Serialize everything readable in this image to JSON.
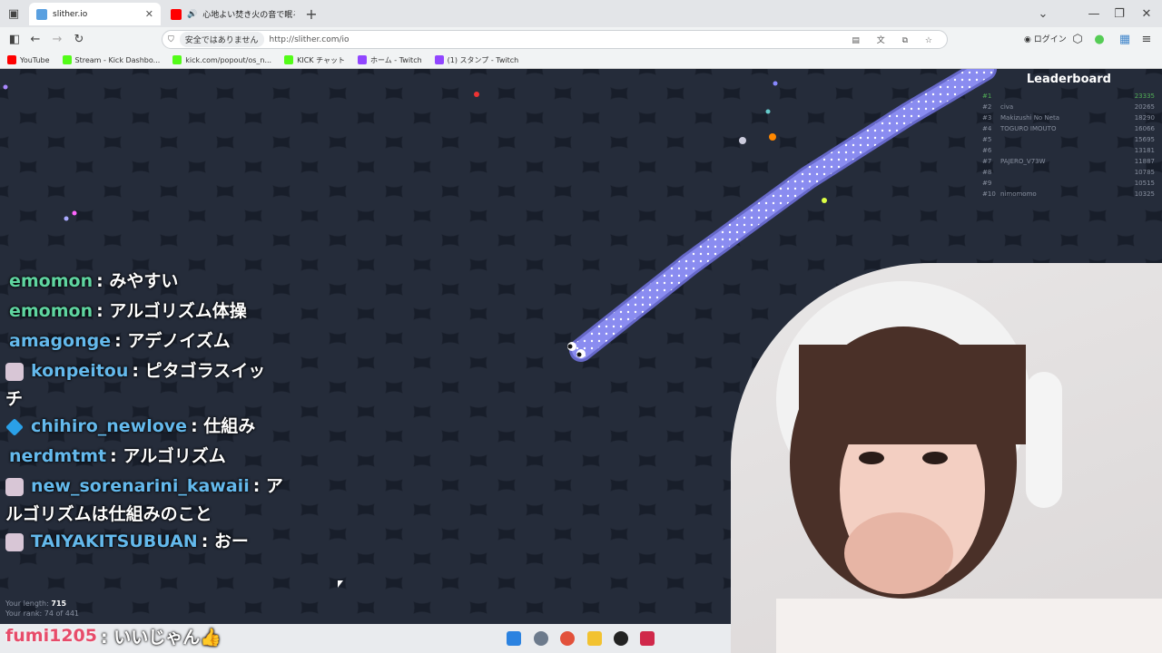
{
  "browser": {
    "tabs": [
      {
        "title": "slither.io",
        "active": true
      },
      {
        "title": "心地よい焚き火の音で眠る前",
        "active": false
      }
    ],
    "new_tab_label": "+",
    "url_security": "安全ではありません",
    "url": "http://slither.com/io",
    "login_label": "ログイン",
    "bookmarks": [
      {
        "label": "YouTube",
        "color": "#ff0000"
      },
      {
        "label": "Stream - Kick Dashbo...",
        "color": "#53fc18"
      },
      {
        "label": "kick.com/popout/os_n...",
        "color": "#53fc18"
      },
      {
        "label": "KICK チャット",
        "color": "#53fc18"
      },
      {
        "label": "ホーム - Twitch",
        "color": "#9146ff"
      },
      {
        "label": "(1) スタンプ - Twitch",
        "color": "#9146ff"
      }
    ]
  },
  "game": {
    "leaderboard_title": "Leaderboard",
    "leaderboard": [
      {
        "rank": "#1",
        "name": "",
        "score": "23335"
      },
      {
        "rank": "#2",
        "name": "civa",
        "score": "20265"
      },
      {
        "rank": "#3",
        "name": "Makizushi No Neta",
        "score": "18290"
      },
      {
        "rank": "#4",
        "name": "TOGURO IMOUTO",
        "score": "16066"
      },
      {
        "rank": "#5",
        "name": "",
        "score": "15695"
      },
      {
        "rank": "#6",
        "name": "",
        "score": "13181"
      },
      {
        "rank": "#7",
        "name": "PAJERO_V73W",
        "score": "11887"
      },
      {
        "rank": "#8",
        "name": "",
        "score": "10785"
      },
      {
        "rank": "#9",
        "name": "",
        "score": "10515"
      },
      {
        "rank": "#10",
        "name": "nimomomo",
        "score": "10325"
      }
    ],
    "length_label": "Your length:",
    "length_value": "715",
    "rank_label": "Your rank: 74 of 441"
  },
  "chat": [
    {
      "user": "emomon",
      "text": ": みやすい",
      "badge": "",
      "user_color": "green"
    },
    {
      "user": "emomon",
      "text": ": アルゴリズム体操",
      "badge": "",
      "user_color": "green"
    },
    {
      "user": "amagonge",
      "text": ": アデノイズム",
      "badge": "",
      "user_color": "blue"
    },
    {
      "user": "konpeitou",
      "text": ": ピタゴラスイッ",
      "wrap": "チ",
      "badge": "avatar",
      "user_color": "blue"
    },
    {
      "user": "chihiro_newlove",
      "text": ": 仕組み",
      "badge": "cube",
      "user_color": "blue"
    },
    {
      "user": "nerdmtmt",
      "text": ": アルゴリズム",
      "badge": "",
      "user_color": "blue"
    },
    {
      "user": "new_sorenarini_kawaii",
      "text": ": ア",
      "wrap": "ルゴリズムは仕組みのこと",
      "badge": "avatar",
      "user_color": "blue"
    },
    {
      "user": "TAIYAKITSUBUAN",
      "text": ": おー",
      "badge": "avatar",
      "user_color": "blue"
    }
  ],
  "last_message": {
    "user": "fumi1205",
    "text": ": いいじゃん👍"
  },
  "colors": {
    "snake": "#8e8ff0",
    "accent": "#64b9ec"
  }
}
